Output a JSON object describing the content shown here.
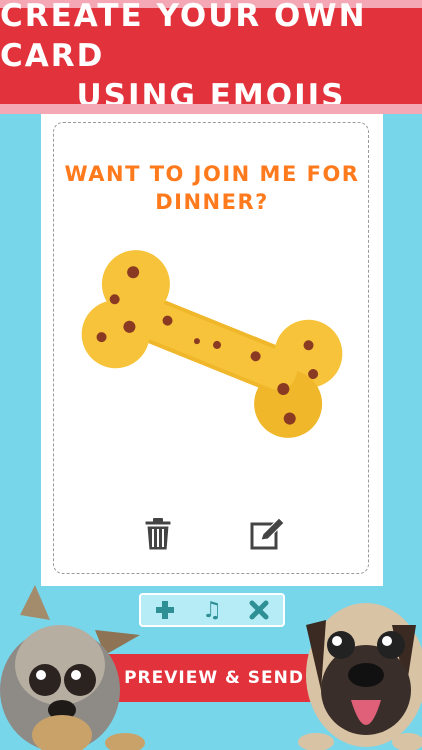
{
  "banner": {
    "line1": "CREATE YOUR OWN CARD",
    "line2": "USING EMOJIS"
  },
  "card": {
    "message_line1": "WANT TO JOIN ME FOR",
    "message_line2": "DINNER?",
    "sticker": "bone-emoji"
  },
  "toolbar": {
    "add_icon": "plus-icon",
    "music_icon": "music-note-icon",
    "clear_icon": "x-icon"
  },
  "actions": {
    "preview_label": "PREVIEW & SEND"
  },
  "colors": {
    "background": "#78d6ea",
    "banner": "#e2333d",
    "message": "#ff7a1c",
    "toolbar_icon": "#2e8f95"
  }
}
